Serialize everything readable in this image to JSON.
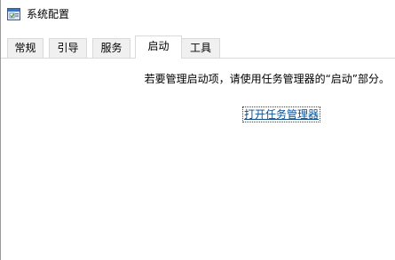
{
  "window": {
    "title": "系统配置",
    "app_icon": "msconfig-window-icon"
  },
  "tabs": [
    {
      "label": "常规",
      "active": false
    },
    {
      "label": "引导",
      "active": false
    },
    {
      "label": "服务",
      "active": false
    },
    {
      "label": "启动",
      "active": true
    },
    {
      "label": "工具",
      "active": false
    }
  ],
  "startup_panel": {
    "message": "若要管理启动项，请使用任务管理器的“启动”部分。",
    "link_label": "打开任务管理器"
  },
  "colors": {
    "link": "#0b4f91",
    "tab_border": "#d9d9d9",
    "inactive_tab_bg": "#f0f0f0"
  }
}
